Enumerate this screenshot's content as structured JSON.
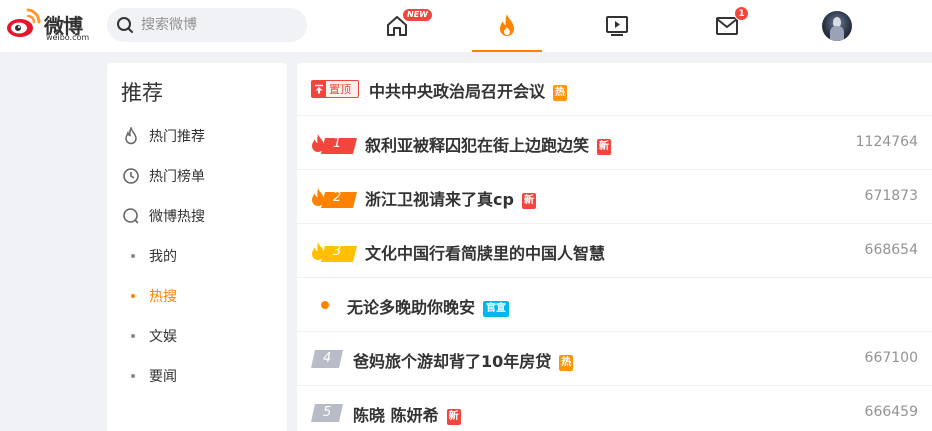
{
  "header": {
    "logo_text": "微博",
    "logo_sub": "weibo.com",
    "search_placeholder": "搜索微博",
    "home_badge": "NEW",
    "message_badge": "1"
  },
  "sidebar": {
    "title": "推荐",
    "items": [
      {
        "label": "热门推荐",
        "icon": "flame-outline-icon"
      },
      {
        "label": "热门榜单",
        "icon": "clock-icon"
      },
      {
        "label": "微博热搜",
        "icon": "search-circle-icon"
      },
      {
        "label": "我的"
      },
      {
        "label": "热搜",
        "active": true
      },
      {
        "label": "文娱"
      },
      {
        "label": "要闻"
      }
    ]
  },
  "hot_list": {
    "pinned": {
      "tag": "置顶",
      "title": "中共中央政治局召开会议",
      "badge": "热"
    },
    "rows": [
      {
        "rank": "1",
        "title": "叙利亚被释囚犯在街上边跑边笑",
        "badge": "新",
        "count": "1124764"
      },
      {
        "rank": "2",
        "title": "浙江卫视请来了真cp",
        "badge": "新",
        "count": "671873"
      },
      {
        "rank": "3",
        "title": "文化中国行看简牍里的中国人智慧",
        "badge": "",
        "count": "668654"
      },
      {
        "rank": "",
        "title": "无论多晚助你晚安",
        "badge": "官宣",
        "count": ""
      },
      {
        "rank": "4",
        "title": "爸妈旅个游却背了10年房贷",
        "badge": "热",
        "count": "667100"
      },
      {
        "rank": "5",
        "title": "陈晓 陈妍希",
        "badge": "新",
        "count": "666459"
      }
    ]
  },
  "colors": {
    "accent": "#ff8200",
    "red": "#f2453d",
    "hot_tag": "#ff9406",
    "gov_tag": "#00b7ee"
  }
}
